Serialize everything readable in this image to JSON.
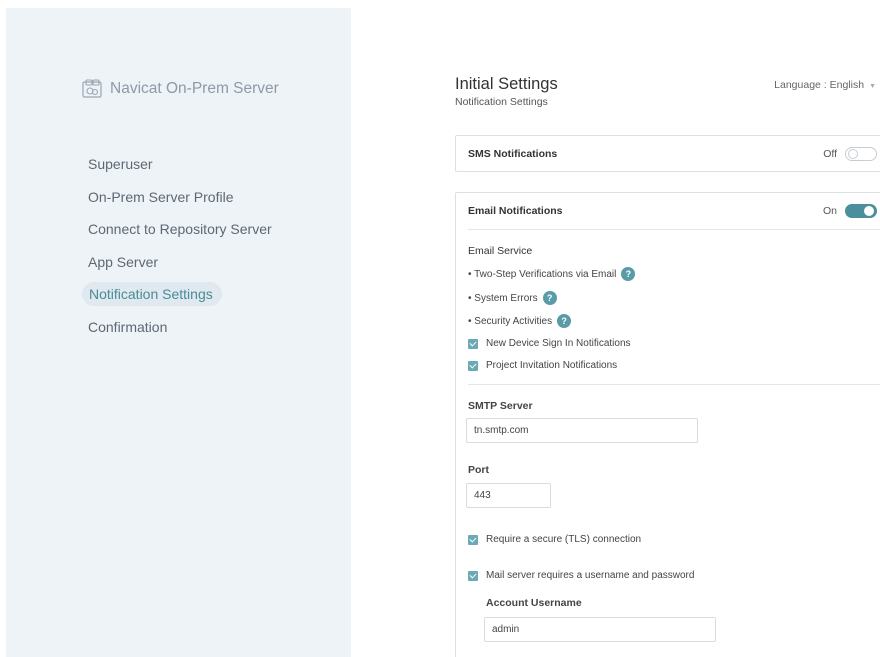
{
  "app": {
    "name": "Navicat On-Prem Server"
  },
  "sidebar": {
    "items": [
      {
        "label": "Superuser"
      },
      {
        "label": "On-Prem Server Profile"
      },
      {
        "label": "Connect to Repository Server"
      },
      {
        "label": "App Server"
      },
      {
        "label": "Notification Settings",
        "active": true
      },
      {
        "label": "Confirmation"
      }
    ]
  },
  "header": {
    "title": "Initial Settings",
    "subtitle": "Notification Settings",
    "language_label": "Language : English"
  },
  "sms": {
    "title": "SMS Notifications",
    "state_label": "Off",
    "enabled": false
  },
  "email": {
    "title": "Email Notifications",
    "state_label": "On",
    "enabled": true,
    "service_label": "Email Service",
    "bullets": [
      {
        "label": "• Two-Step Verifications via Email"
      },
      {
        "label": "• System Errors"
      },
      {
        "label": "• Security Activities"
      }
    ],
    "checkboxes": [
      {
        "label": "New Device Sign In Notifications",
        "checked": true
      },
      {
        "label": "Project Invitation Notifications",
        "checked": true
      }
    ],
    "smtp_label": "SMTP Server",
    "smtp_value": "tn.smtp.com",
    "port_label": "Port",
    "port_value": "443",
    "tls_label": "Require a secure (TLS) connection",
    "tls_checked": true,
    "auth_label": "Mail server requires a username and password",
    "auth_checked": true,
    "username_label": "Account Username",
    "username_value": "admin"
  },
  "colors": {
    "accent": "#4a8f9b",
    "sidebar_bg": "#eef3f8",
    "active_pill": "#dfe9ef"
  },
  "icons": {
    "logo": "navicat-logo-icon",
    "help": "question-icon",
    "caret": "caret-down-icon"
  }
}
